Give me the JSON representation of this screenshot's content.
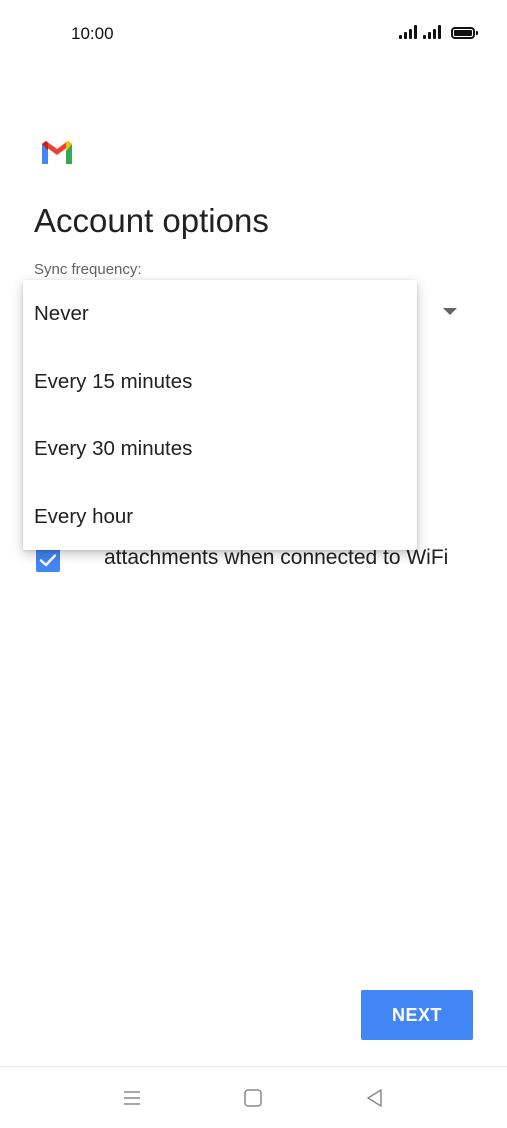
{
  "status_bar": {
    "time": "10:00",
    "icons": [
      "cellular-signal-icon",
      "cellular-signal-icon",
      "battery-icon"
    ]
  },
  "app": {
    "logo_icon": "gmail-logo-icon"
  },
  "page": {
    "title": "Account options"
  },
  "sync": {
    "label": "Sync frequency:",
    "options": [
      "Never",
      "Every 15 minutes",
      "Every 30 minutes",
      "Every hour"
    ]
  },
  "download": {
    "checked": true,
    "label": "attachments when connected to WiFi"
  },
  "actions": {
    "next_label": "NEXT"
  },
  "nav": {
    "icons": [
      "menu-icon",
      "home-icon",
      "back-icon"
    ]
  },
  "colors": {
    "accent": "#4285f4",
    "text_primary": "#202124",
    "text_secondary": "#5f6368"
  }
}
